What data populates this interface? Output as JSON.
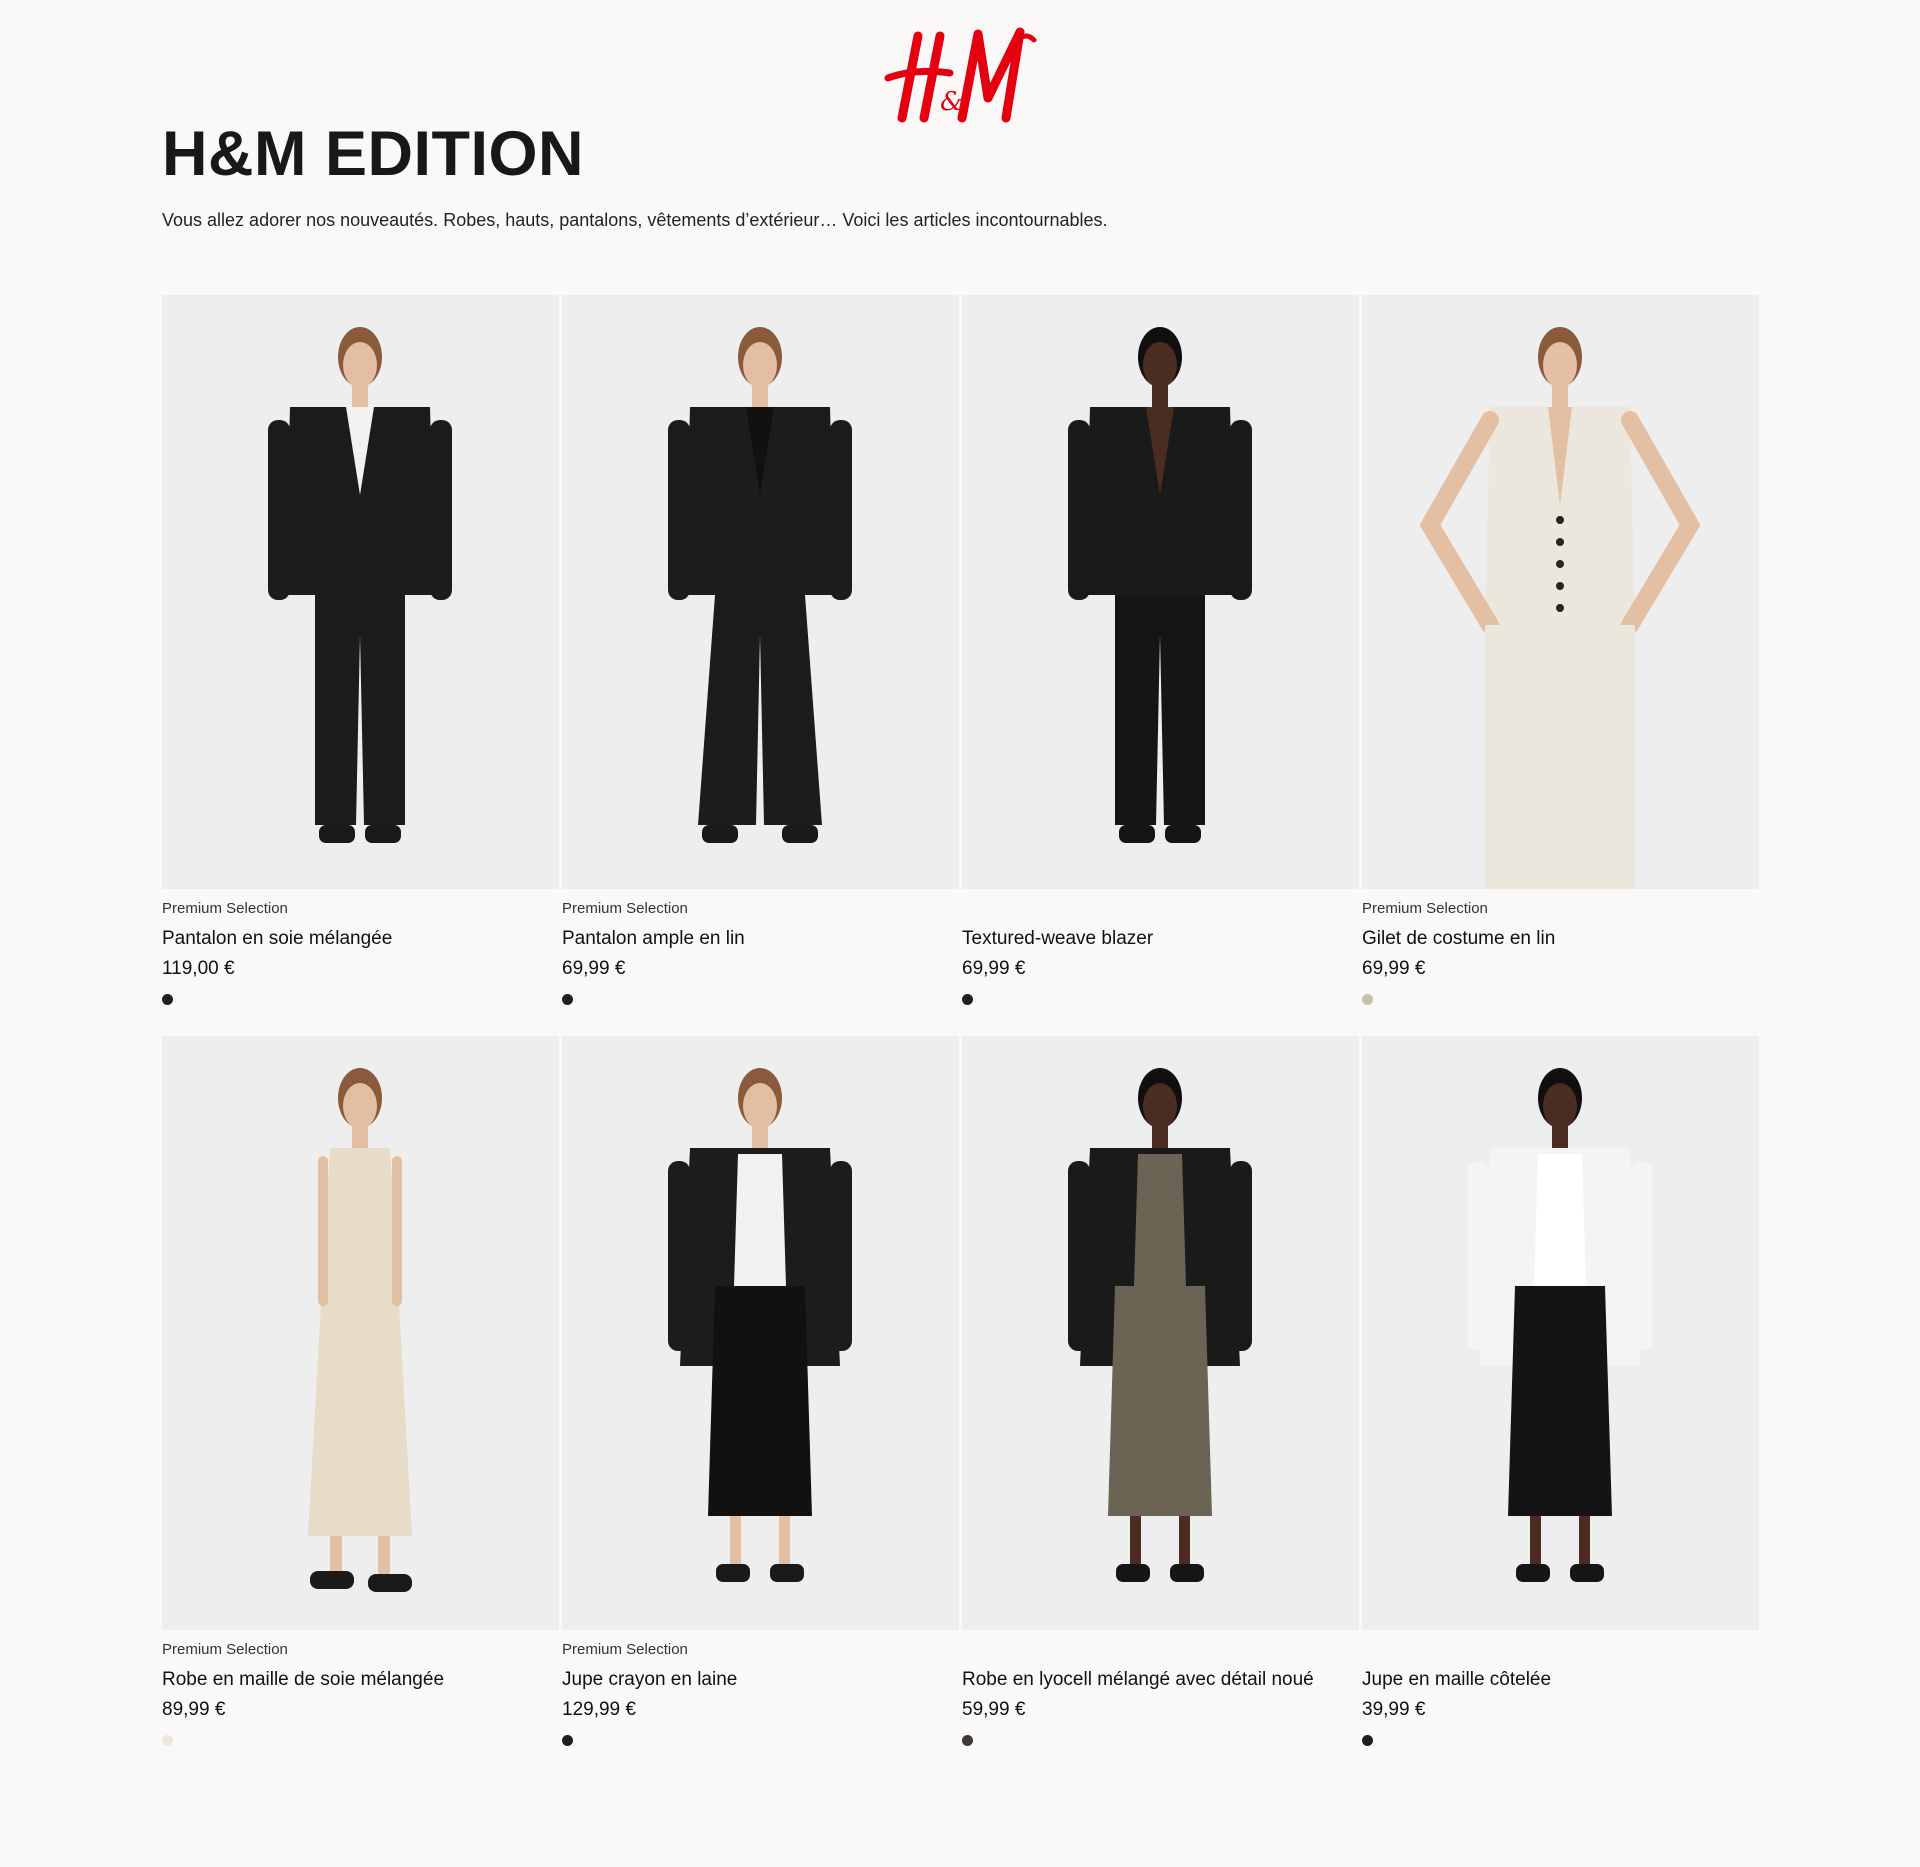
{
  "brand": {
    "logo_text": "H&M",
    "logo_color": "#e50010"
  },
  "header": {
    "title": "H&M EDITION",
    "description": "Vous allez adorer nos nouveautés. Robes, hauts, pantalons, vêtements d’extérieur… Voici les articles incontournables."
  },
  "products": [
    {
      "eyebrow": "Premium Selection",
      "name": "Pantalon en soie mélangée",
      "price": "119,00 €",
      "swatch": "#1f1f1f",
      "model": {
        "skin": "#e2bea3",
        "hair": "#8a5a3a",
        "top": "#1c1c1d",
        "inner": "#f1f1f1",
        "bottom": "#1c1c1d",
        "shoe": "#1a1a1a",
        "style": "suit"
      }
    },
    {
      "eyebrow": "Premium Selection",
      "name": "Pantalon ample en lin",
      "price": "69,99 €",
      "swatch": "#1f1f1f",
      "model": {
        "skin": "#e2bea3",
        "hair": "#8a5a3a",
        "top": "#1c1c1d",
        "inner": "#111111",
        "bottom": "#1c1c1d",
        "shoe": "#1a1a1a",
        "style": "wide"
      }
    },
    {
      "eyebrow": "",
      "name": "Textured-weave blazer",
      "price": "69,99 €",
      "swatch": "#1f1f1f",
      "model": {
        "skin": "#4a2d20",
        "hair": "#101010",
        "top": "#1a1a1a",
        "inner": "#4a2d20",
        "bottom": "#151515",
        "shoe": "#151515",
        "style": "blazer"
      }
    },
    {
      "eyebrow": "Premium Selection",
      "name": "Gilet de costume en lin",
      "price": "69,99 €",
      "swatch": "#cbbfad",
      "model": {
        "skin": "#e3bfa4",
        "hair": "#8a5a3a",
        "top": "#ece7dc",
        "inner": "#e3bfa4",
        "bottom": "#ece7dc",
        "shoe": "#ece7dc",
        "style": "vest"
      }
    },
    {
      "eyebrow": "Premium Selection",
      "name": "Robe en maille de soie mélangée",
      "price": "89,99 €",
      "swatch": "#ebe7dc",
      "model": {
        "skin": "#e2bea3",
        "hair": "#8a5a3a",
        "top": "#e6dcc8",
        "inner": "#e6dcc8",
        "bottom": "#e6dcc8",
        "shoe": "#1a1a1a",
        "style": "dress"
      }
    },
    {
      "eyebrow": "Premium Selection",
      "name": "Jupe crayon en laine",
      "price": "129,99 €",
      "swatch": "#1f1f1f",
      "model": {
        "skin": "#e2bea3",
        "hair": "#8a5a3a",
        "top": "#1c1c1d",
        "inner": "#f1f1f1",
        "bottom": "#111111",
        "shoe": "#1a1a1a",
        "style": "leather"
      }
    },
    {
      "eyebrow": "",
      "name": "Robe en lyocell mélangé avec détail noué",
      "price": "59,99 €",
      "swatch": "#3e3a33",
      "model": {
        "skin": "#4a2d20",
        "hair": "#101010",
        "top": "#1a1a1a",
        "inner": "#6b6455",
        "bottom": "#6b6455",
        "shoe": "#151515",
        "style": "snake"
      }
    },
    {
      "eyebrow": "",
      "name": "Jupe en maille côtelée",
      "price": "39,99 €",
      "swatch": "#1f1f1f",
      "model": {
        "skin": "#4a2d20",
        "hair": "#101010",
        "top": "#f4f4f4",
        "inner": "#ffffff",
        "bottom": "#141414",
        "shoe": "#151515",
        "style": "skirt"
      }
    }
  ]
}
